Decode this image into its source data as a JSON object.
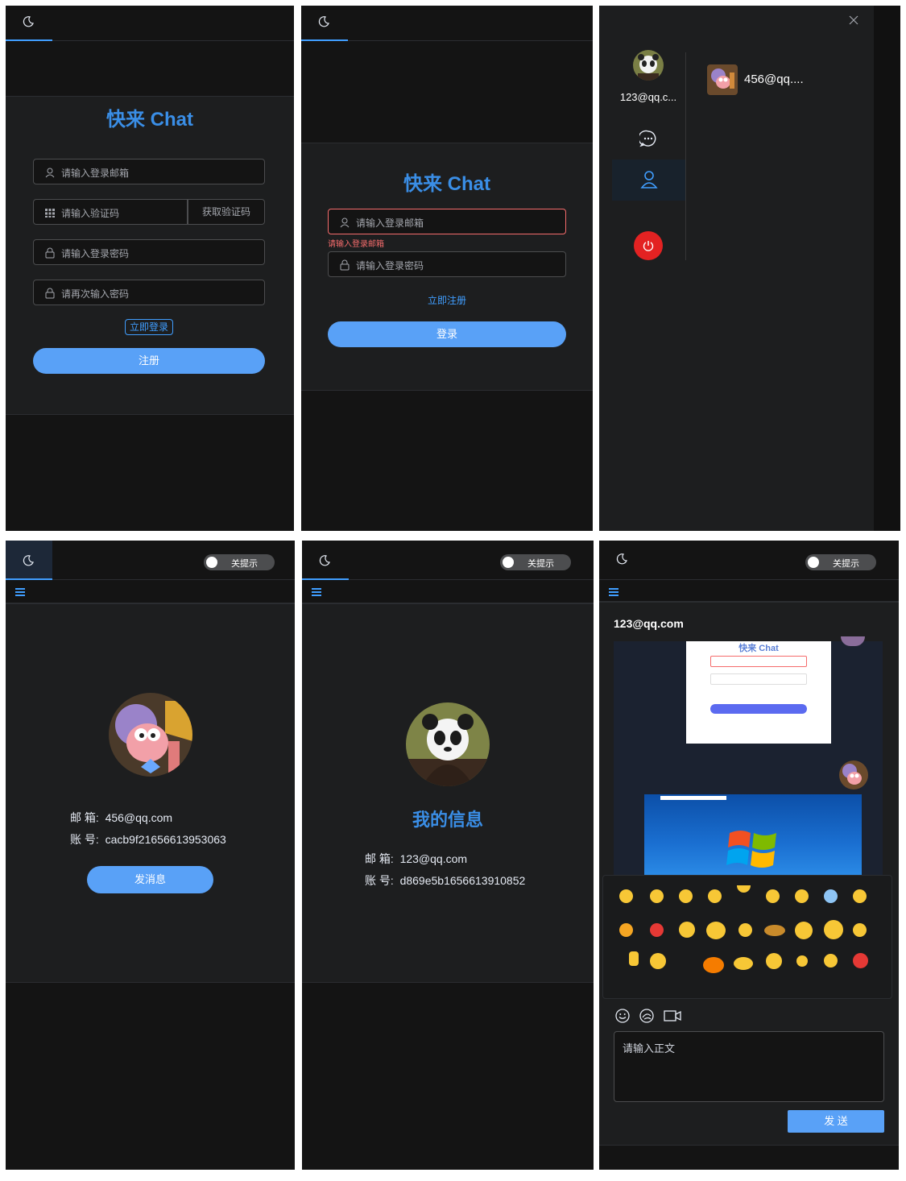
{
  "register": {
    "title": "快来 Chat",
    "email_placeholder": "请输入登录邮箱",
    "code_placeholder": "请输入验证码",
    "get_code": "获取验证码",
    "password_placeholder": "请输入登录密码",
    "password_again_placeholder": "请再次输入密码",
    "login_link": "立即登录",
    "submit": "注册"
  },
  "login": {
    "title": "快来 Chat",
    "email_placeholder": "请输入登录邮箱",
    "email_error": "请输入登录邮箱",
    "password_placeholder": "请输入登录密码",
    "register_link": "立即注册",
    "submit": "登录"
  },
  "friends": {
    "me_name": "123@qq.c...",
    "contact_name": "456@qq...."
  },
  "header": {
    "toggle_label": "关提示"
  },
  "friend_profile": {
    "email_label": "邮 箱:",
    "email": "456@qq.com",
    "account_label": "账 号:",
    "account": "cacb9f21656613953063",
    "send_button": "发消息"
  },
  "my_profile": {
    "title": "我的信息",
    "email_label": "邮 箱:",
    "email": "123@qq.com",
    "account_label": "账 号:",
    "account": "d869e5b1656613910852"
  },
  "chat": {
    "peer": "123@qq.com",
    "screenshot_title": "快来 Chat",
    "input_placeholder": "请输入正文",
    "send_button": "发 送"
  },
  "colors": {
    "accent": "#409eff",
    "title_blue": "#3a8ee6",
    "button_blue": "#59a1f7",
    "danger": "#f56c6c",
    "bg": "#141414",
    "card": "#1d1e1f"
  }
}
